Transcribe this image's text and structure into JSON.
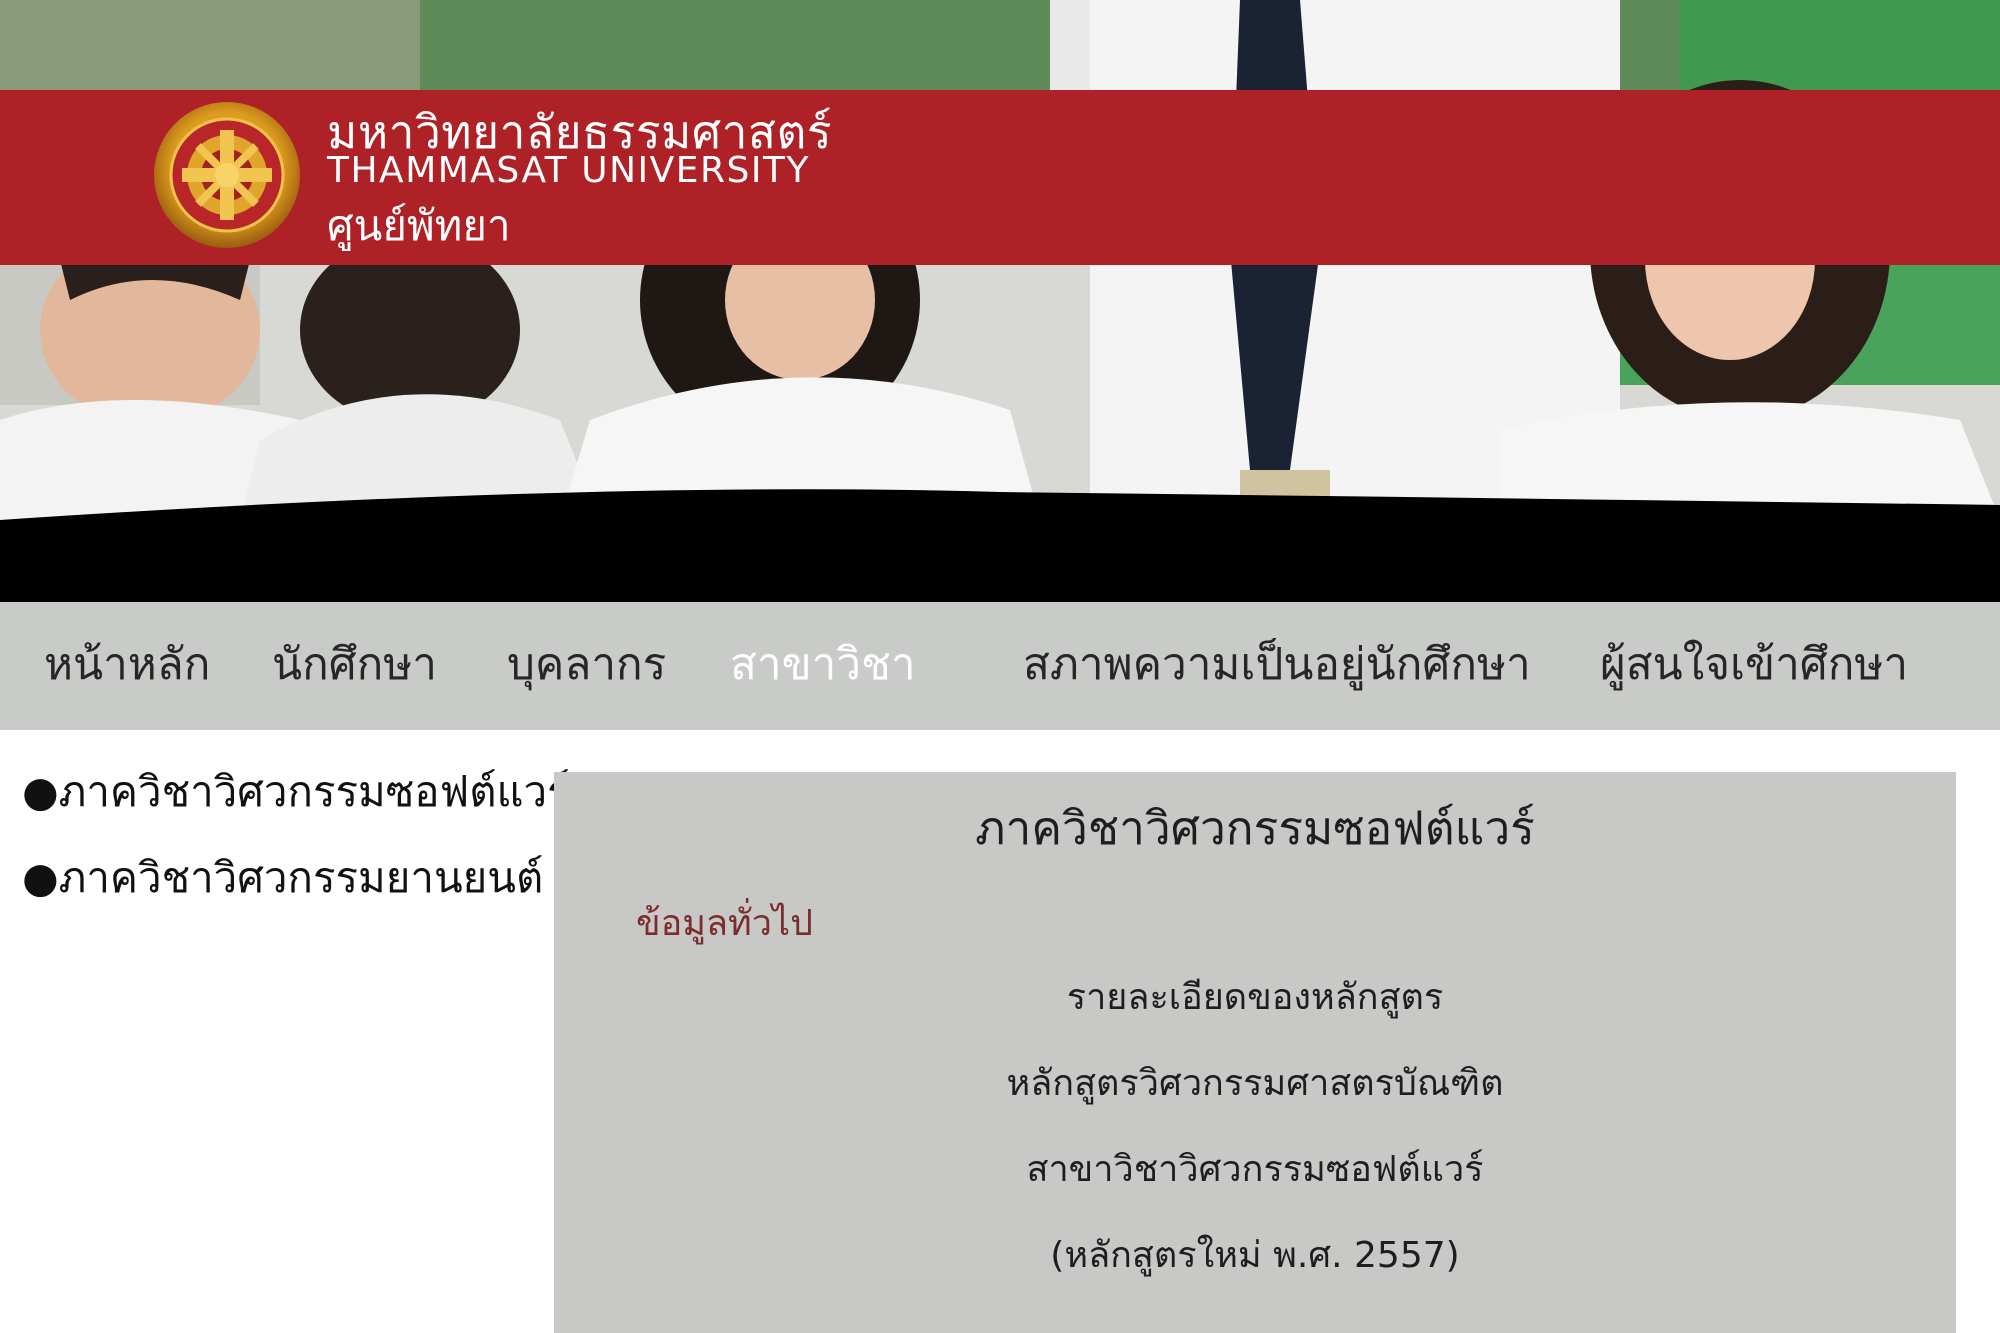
{
  "header": {
    "university_name_thai": "มหาวิทยาลัยธรรมศาสตร์",
    "university_name_english": "THAMMASAT UNIVERSITY",
    "campus_name": "ศูนย์พัทยา",
    "seal_text": "มหาวิทยาลัยธรรมศาสตร์ THAMMASAT UNIVERSITY",
    "banner_color": "#ae2126"
  },
  "nav": {
    "items": [
      {
        "label": "หน้าหลัก",
        "active": false
      },
      {
        "label": "นักศึกษา",
        "active": false
      },
      {
        "label": "บุคลากร",
        "active": false
      },
      {
        "label": "สาขาวิชา",
        "active": true
      },
      {
        "label": "สภาพความเป็นอยู่นักศึกษา",
        "active": false
      },
      {
        "label": "ผู้สนใจเข้าศึกษา",
        "active": false
      }
    ],
    "background": "#c9cbc8",
    "active_color": "#ffffff"
  },
  "sidebar": {
    "items": [
      {
        "label": "●ภาควิชาวิศวกรรมซอฟต์แวร์"
      },
      {
        "label": "●ภาควิชาวิศวกรรมยานยนต์"
      }
    ]
  },
  "content": {
    "title": "ภาควิชาวิศวกรรมซอฟต์แวร์",
    "subtitle": "ข้อมูลทั่วไป",
    "lines": [
      "รายละเอียดของหลักสูตร",
      "หลักสูตรวิศวกรรมศาสตรบัณฑิต",
      "สาขาวิชาวิศวกรรมซอฟต์แวร์",
      "(หลักสูตรใหม่ พ.ศ. 2557)"
    ],
    "subtitle_color": "#7a2d2d"
  },
  "icons": {
    "seal": "university-seal-icon"
  }
}
